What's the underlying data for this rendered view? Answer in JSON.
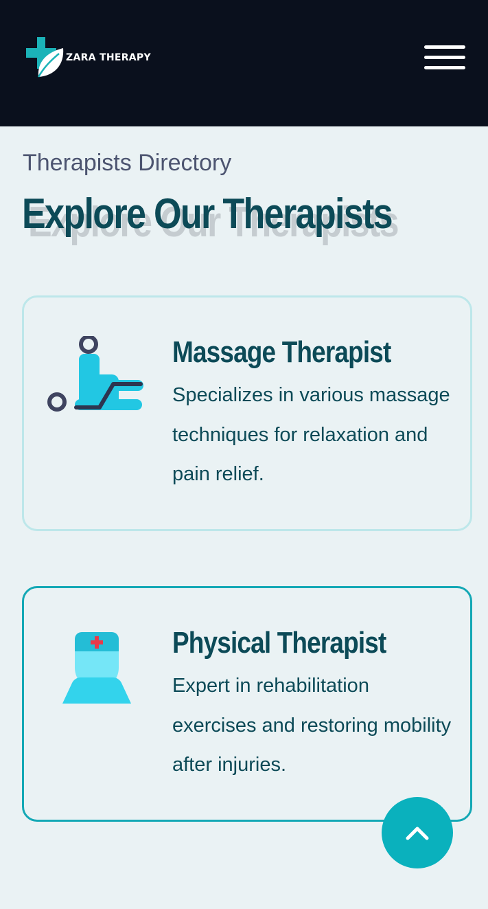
{
  "header": {
    "brand": "ZARA THERAPY",
    "logo_icon": "medical-cross-leaf-logo",
    "menu_icon": "hamburger-menu-icon",
    "background": "#0a101d"
  },
  "section": {
    "eyebrow": "Therapists Directory",
    "title": "Explore Our Therapists"
  },
  "cards": [
    {
      "title": "Massage Therapist",
      "description": "Specializes in various massage techniques for relaxation and pain relief.",
      "icon": "massage-therapy-icon"
    },
    {
      "title": "Physical Therapist",
      "description": "Expert in rehabilitation exercises and restoring mobility after injuries.",
      "icon": "physical-therapist-icon"
    }
  ],
  "scroll_top": {
    "icon": "chevron-up-icon"
  },
  "colors": {
    "accent": "#0ab1bd",
    "heading": "#0c4a57",
    "page_background": "#eaf2f4"
  }
}
